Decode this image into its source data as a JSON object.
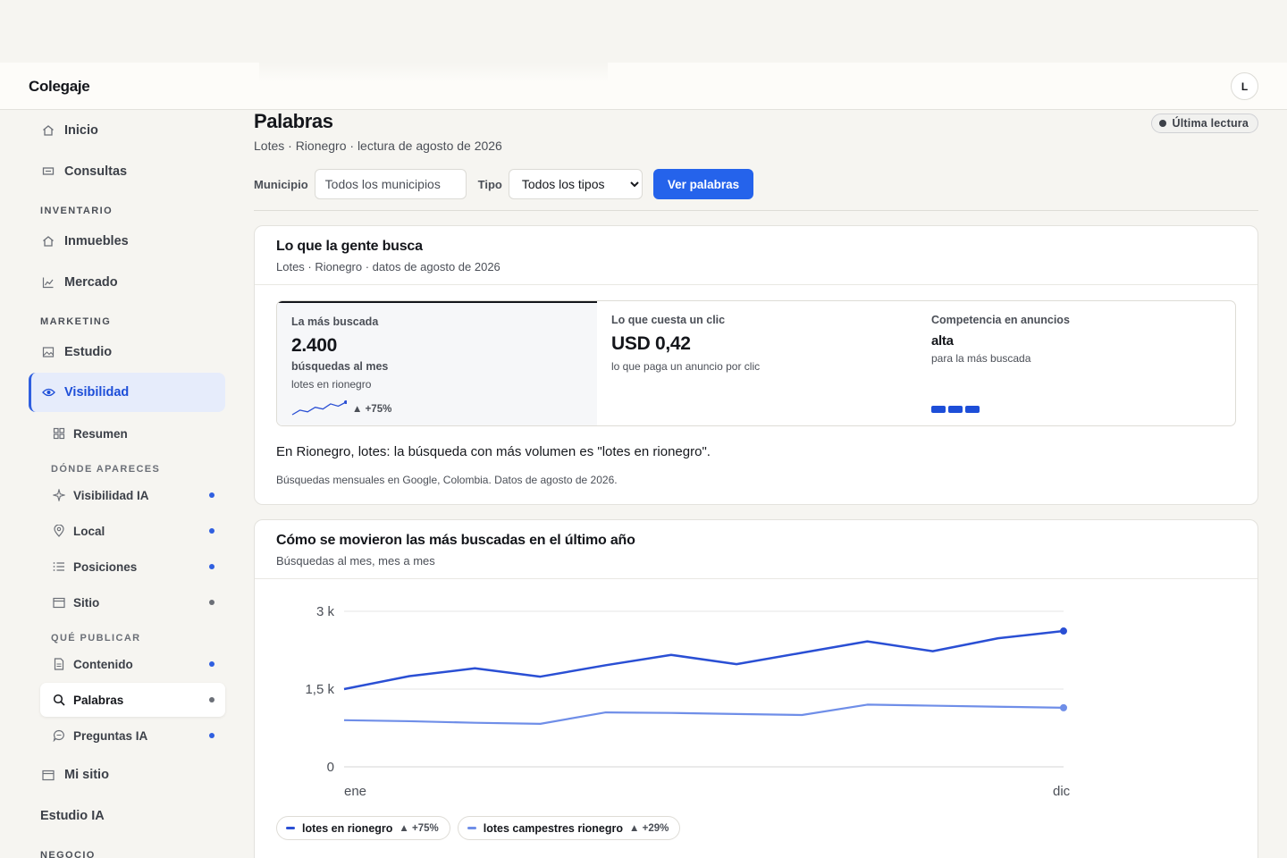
{
  "app": {
    "brand": "Colegaje",
    "avatar_initial": "L"
  },
  "sidebar": {
    "main_items": [
      {
        "label": "Inicio",
        "icon": "home-icon"
      },
      {
        "label": "Consultas",
        "icon": "message-icon"
      }
    ],
    "inventario_label": "INVENTARIO",
    "inventario_items": [
      {
        "label": "Inmuebles",
        "icon": "home-icon"
      },
      {
        "label": "Mercado",
        "icon": "line-chart-icon"
      }
    ],
    "marketing_label": "MARKETING",
    "marketing_items": [
      {
        "label": "Estudio",
        "icon": "image-icon"
      },
      {
        "label": "Visibilidad",
        "icon": "eye-icon",
        "active": true
      }
    ],
    "resumen": {
      "label": "Resumen",
      "icon": "grid-icon"
    },
    "donde_label": "DÓNDE APARECES",
    "donde_items": [
      {
        "label": "Visibilidad IA",
        "icon": "sparkle-icon",
        "dot": "blue"
      },
      {
        "label": "Local",
        "icon": "map-pin-icon",
        "dot": "blue"
      },
      {
        "label": "Posiciones",
        "icon": "list-icon",
        "dot": "blue"
      },
      {
        "label": "Sitio",
        "icon": "browser-icon",
        "dot": "gray"
      }
    ],
    "que_label": "QUÉ PUBLICAR",
    "que_items": [
      {
        "label": "Contenido",
        "icon": "document-icon",
        "dot": "blue"
      },
      {
        "label": "Palabras",
        "icon": "search-icon",
        "dot": "gray",
        "current": true
      },
      {
        "label": "Preguntas IA",
        "icon": "chat-icon",
        "dot": "blue"
      }
    ],
    "mi_sitio": {
      "label": "Mi sitio",
      "icon": "browser-icon"
    },
    "estudio_ia": "Estudio IA",
    "negocio_label": "NEGOCIO"
  },
  "header": {
    "title": "Palabras",
    "subtitle": "Lotes · Rionegro · lectura de agosto de 2026",
    "badge": "Última lectura"
  },
  "filters": {
    "municipio_label": "Municipio",
    "municipio_placeholder": "Todos los municipios",
    "tipo_label": "Tipo",
    "tipo_selected": "Todos los tipos",
    "button": "Ver palabras"
  },
  "card1": {
    "title": "Lo que la gente busca",
    "subtitle": "Lotes · Rionegro · datos de agosto de 2026",
    "kpi_top": {
      "label": "La más buscada",
      "value": "2.400",
      "unit": "búsquedas al mes",
      "keyword": "lotes en rionegro",
      "change": "▲ +75%",
      "sparkline": [
        1.5,
        1.9,
        1.75,
        2.15,
        2.0,
        2.45,
        2.25,
        2.6
      ]
    },
    "kpi_cpc": {
      "label": "Lo que cuesta un clic",
      "value": "USD 0,42",
      "note": "lo que paga un anuncio por clic"
    },
    "kpi_comp": {
      "label": "Competencia en anuncios",
      "value": "alta",
      "note": "para la más buscada",
      "level": 3
    },
    "sentence": "En Rionegro, lotes: la búsqueda con más volumen es \"lotes en rionegro\".",
    "source": "Búsquedas mensuales en Google, Colombia. Datos de agosto de 2026."
  },
  "card2": {
    "title": "Cómo se movieron las más buscadas en el último año",
    "subtitle": "Búsquedas al mes, mes a mes"
  },
  "chart_data": {
    "type": "line",
    "y_ticks": [
      "3 k",
      "1,5 k",
      "0"
    ],
    "y_tick_values": [
      3000,
      1500,
      0
    ],
    "x_labels": [
      "ene",
      "dic"
    ],
    "ylim": [
      0,
      3000
    ],
    "grid": true,
    "colors": {
      "primary": "#2a4fd4",
      "secondary": "#6f8ee8"
    },
    "series": [
      {
        "name": "lotes en rionegro",
        "change": "▲ +75%",
        "color": "#2a4fd4",
        "values": [
          1500,
          1750,
          1900,
          1740,
          1960,
          2160,
          1980,
          2200,
          2420,
          2230,
          2480,
          2620
        ]
      },
      {
        "name": "lotes campestres rionegro",
        "change": "▲ +29%",
        "color": "#6f8ee8",
        "values": [
          900,
          880,
          850,
          830,
          1050,
          1040,
          1020,
          1000,
          1200,
          1180,
          1160,
          1140
        ]
      }
    ]
  }
}
